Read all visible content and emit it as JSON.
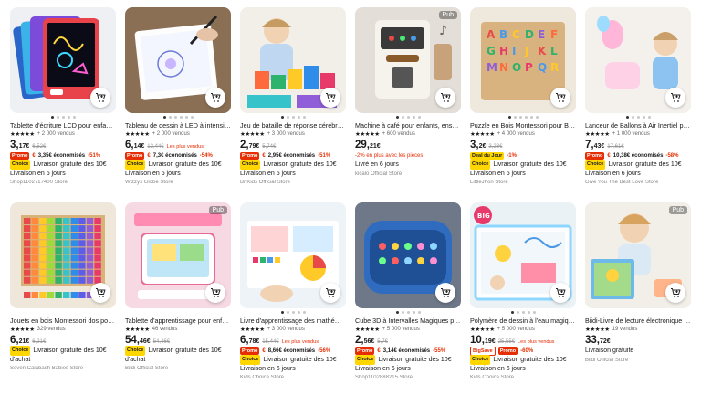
{
  "products": [
    {
      "title": "Tablette d'écriture LCD pour enfant...",
      "stars": "★★★★★",
      "sold": "+ 2 000 vendus",
      "price_main": "3,",
      "price_small": "17€",
      "old_price": "6,52€",
      "best_seller": "",
      "promo_badge": "Promo",
      "promo_icon": "coin-icon",
      "promo_text": "3,35€ économisés",
      "promo_pct": "-51%",
      "choice_badge": "Choice",
      "ship1": "Livraison gratuite dès 10€",
      "ship2": "Livraison en 6 jours",
      "store": "Shop1102717400 Store",
      "pub": "",
      "dots": 5,
      "active_dot": 0,
      "image": "lcd-tablet"
    },
    {
      "title": "Tableau de dessin à LED à intensité ...",
      "stars": "★★★★★",
      "sold": "+ 2 000 vendus",
      "price_main": "6,",
      "price_small": "14€",
      "old_price": "13,44€",
      "best_seller": "Les plus vendus",
      "promo_badge": "Promo",
      "promo_icon": "coin-icon",
      "promo_text": "7,3€ économisés",
      "promo_pct": "-54%",
      "choice_badge": "Choice",
      "ship1": "Livraison gratuite dès 10€",
      "ship2": "Livraison en 6 jours",
      "store": "Wizzys Globe Store",
      "pub": "",
      "dots": 6,
      "active_dot": 0,
      "image": "led-board"
    },
    {
      "title": "Jeu de bataille de réponse cérébrale-...",
      "stars": "★★★★★",
      "sold": "+ 3 000 vendus",
      "price_main": "2,",
      "price_small": "79€",
      "old_price": "5,74€",
      "best_seller": "",
      "promo_badge": "Promo",
      "promo_icon": "coin-icon",
      "promo_text": "2,95€ économisés",
      "promo_pct": "-51%",
      "choice_badge": "Choice",
      "ship1": "Livraison gratuite dès 10€",
      "ship2": "Livraison en 6 jours",
      "store": "BriKids Official Store",
      "pub": "",
      "dots": 5,
      "active_dot": 0,
      "image": "stacking-cups"
    },
    {
      "title": "Machine à café pour enfants, ense...",
      "stars": "★★★★★",
      "sold": "+ 600 vendus",
      "price_main": "29,",
      "price_small": "21€",
      "old_price": "",
      "best_seller": "",
      "promo_badge": "",
      "promo_icon": "",
      "promo_text": "-2% en plus avec les pièces",
      "promo_pct": "",
      "choice_badge": "",
      "ship1": "Livré en 6 jours",
      "ship2": "",
      "store": "kicalo Official Store",
      "pub": "Pub",
      "dots": 5,
      "active_dot": 0,
      "image": "coffee-machine"
    },
    {
      "title": "Puzzle en Bois Montessori pour Bébé...",
      "stars": "★★★★★",
      "sold": "+ 4 000 vendus",
      "price_main": "3,",
      "price_small": "2€",
      "old_price": "3,23€",
      "best_seller": "",
      "promo_badge": "Deal du Jour",
      "promo_icon": "",
      "promo_text": "",
      "promo_pct": "-1%",
      "choice_badge": "Choice",
      "ship1": "Livraison gratuite dès 10€",
      "ship2": "Livraison en 6 jours",
      "store": "LittleJhon Store",
      "pub": "",
      "dots": 6,
      "active_dot": 0,
      "image": "wood-puzzle"
    },
    {
      "title": "Lanceur de Ballons à Air Inertiel po...",
      "stars": "★★★★★",
      "sold": "+ 1 000 vendus",
      "price_main": "7,",
      "price_small": "43€",
      "old_price": "17,61€",
      "best_seller": "",
      "promo_badge": "Promo",
      "promo_icon": "coin-icon",
      "promo_text": "10,38€ économisés",
      "promo_pct": "-58%",
      "choice_badge": "Choice",
      "ship1": "Livraison gratuite dès 10€",
      "ship2": "Livraison en 6 jours",
      "store": "Give You The Best Love Store",
      "pub": "",
      "dots": 5,
      "active_dot": 0,
      "image": "balloon-launcher"
    },
    {
      "title": "Jouets en bois Montessori dos pour ...",
      "stars": "★★★★★",
      "sold": "329 vendus",
      "price_main": "6,",
      "price_small": "21€",
      "old_price": "6,21€",
      "best_seller": "",
      "promo_badge": "",
      "promo_icon": "",
      "promo_text": "",
      "promo_pct": "",
      "choice_badge": "Choice",
      "ship1": "Livraison gratuite dès 10€",
      "ship2": "d'achat",
      "store": "Seven Calabash Babies Store",
      "pub": "",
      "dots": 0,
      "active_dot": 0,
      "image": "number-board"
    },
    {
      "title": "Tablette d'apprentissage pour enfa...",
      "stars": "★★★★★",
      "sold": "46 vendus",
      "price_main": "54,",
      "price_small": "46€",
      "old_price": "54,46€",
      "best_seller": "",
      "promo_badge": "",
      "promo_icon": "",
      "promo_text": "",
      "promo_pct": "",
      "choice_badge": "Choice",
      "ship1": "Livraison gratuite dès 10€",
      "ship2": "d'achat",
      "store": "Bildi Official Store",
      "pub": "Pub",
      "dots": 0,
      "active_dot": 0,
      "image": "learning-tablet"
    },
    {
      "title": "Livre d'apprentissage des mathéma...",
      "stars": "★★★★★",
      "sold": "+ 3 000 vendus",
      "price_main": "6,",
      "price_small": "78€",
      "old_price": "15,44€",
      "best_seller": "Les plus vendus",
      "promo_badge": "Promo",
      "promo_icon": "coin-icon",
      "promo_text": "8,66€ économisés",
      "promo_pct": "-56%",
      "choice_badge": "Choice",
      "ship1": "Livraison gratuite dès 10€",
      "ship2": "Livraison en 6 jours",
      "store": "Kids Choice Store",
      "pub": "",
      "dots": 5,
      "active_dot": 0,
      "image": "math-book"
    },
    {
      "title": "Cube 3D à Intervalles Magiques pou...",
      "stars": "★★★★★",
      "sold": "+ 5 000 vendus",
      "price_main": "2,",
      "price_small": "56€",
      "old_price": "5,7€",
      "best_seller": "",
      "promo_badge": "Promo",
      "promo_icon": "coin-icon",
      "promo_text": "3,14€ économisés",
      "promo_pct": "-55%",
      "choice_badge": "Choice",
      "ship1": "Livraison gratuite dès 10€",
      "ship2": "Livraison en 6 jours",
      "store": "Shop1102888215 Store",
      "pub": "",
      "dots": 5,
      "active_dot": 0,
      "image": "magic-cube"
    },
    {
      "title": "Polymère de dessin à l'eau magique...",
      "stars": "★★★★★",
      "sold": "+ 5 000 vendus",
      "price_main": "10,",
      "price_small": "19€",
      "old_price": "25,55€",
      "best_seller": "Les plus vendus",
      "promo_badge": "BigSave",
      "promo_icon": "",
      "promo_text": "Promo",
      "promo_pct": "-60%",
      "choice_badge": "Choice",
      "ship1": "Livraison gratuite dès 10€",
      "ship2": "Livraison en 6 jours",
      "store": "Kids Choice Store",
      "pub": "",
      "dots": 5,
      "active_dot": 0,
      "image": "water-mat"
    },
    {
      "title": "Biidi-Livre de lecture électronique p...",
      "stars": "★★★★★",
      "sold": "19 vendus",
      "price_main": "33,",
      "price_small": "72€",
      "old_price": "",
      "best_seller": "",
      "promo_badge": "",
      "promo_icon": "",
      "promo_text": "",
      "promo_pct": "",
      "choice_badge": "",
      "ship1": "Livraison gratuite",
      "ship2": "",
      "store": "Bildi Official Store",
      "pub": "Pub",
      "dots": 0,
      "active_dot": 0,
      "image": "reading-book"
    }
  ]
}
